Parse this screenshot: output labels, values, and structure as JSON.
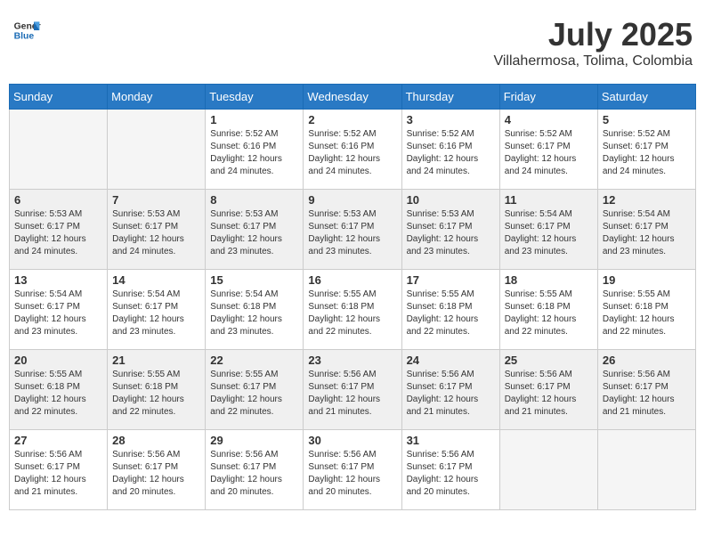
{
  "header": {
    "logo_general": "General",
    "logo_blue": "Blue",
    "month_title": "July 2025",
    "location": "Villahermosa, Tolima, Colombia"
  },
  "weekdays": [
    "Sunday",
    "Monday",
    "Tuesday",
    "Wednesday",
    "Thursday",
    "Friday",
    "Saturday"
  ],
  "weeks": [
    [
      {
        "day": "",
        "info": ""
      },
      {
        "day": "",
        "info": ""
      },
      {
        "day": "1",
        "info": "Sunrise: 5:52 AM\nSunset: 6:16 PM\nDaylight: 12 hours and 24 minutes."
      },
      {
        "day": "2",
        "info": "Sunrise: 5:52 AM\nSunset: 6:16 PM\nDaylight: 12 hours and 24 minutes."
      },
      {
        "day": "3",
        "info": "Sunrise: 5:52 AM\nSunset: 6:16 PM\nDaylight: 12 hours and 24 minutes."
      },
      {
        "day": "4",
        "info": "Sunrise: 5:52 AM\nSunset: 6:17 PM\nDaylight: 12 hours and 24 minutes."
      },
      {
        "day": "5",
        "info": "Sunrise: 5:52 AM\nSunset: 6:17 PM\nDaylight: 12 hours and 24 minutes."
      }
    ],
    [
      {
        "day": "6",
        "info": "Sunrise: 5:53 AM\nSunset: 6:17 PM\nDaylight: 12 hours and 24 minutes."
      },
      {
        "day": "7",
        "info": "Sunrise: 5:53 AM\nSunset: 6:17 PM\nDaylight: 12 hours and 24 minutes."
      },
      {
        "day": "8",
        "info": "Sunrise: 5:53 AM\nSunset: 6:17 PM\nDaylight: 12 hours and 23 minutes."
      },
      {
        "day": "9",
        "info": "Sunrise: 5:53 AM\nSunset: 6:17 PM\nDaylight: 12 hours and 23 minutes."
      },
      {
        "day": "10",
        "info": "Sunrise: 5:53 AM\nSunset: 6:17 PM\nDaylight: 12 hours and 23 minutes."
      },
      {
        "day": "11",
        "info": "Sunrise: 5:54 AM\nSunset: 6:17 PM\nDaylight: 12 hours and 23 minutes."
      },
      {
        "day": "12",
        "info": "Sunrise: 5:54 AM\nSunset: 6:17 PM\nDaylight: 12 hours and 23 minutes."
      }
    ],
    [
      {
        "day": "13",
        "info": "Sunrise: 5:54 AM\nSunset: 6:17 PM\nDaylight: 12 hours and 23 minutes."
      },
      {
        "day": "14",
        "info": "Sunrise: 5:54 AM\nSunset: 6:17 PM\nDaylight: 12 hours and 23 minutes."
      },
      {
        "day": "15",
        "info": "Sunrise: 5:54 AM\nSunset: 6:18 PM\nDaylight: 12 hours and 23 minutes."
      },
      {
        "day": "16",
        "info": "Sunrise: 5:55 AM\nSunset: 6:18 PM\nDaylight: 12 hours and 22 minutes."
      },
      {
        "day": "17",
        "info": "Sunrise: 5:55 AM\nSunset: 6:18 PM\nDaylight: 12 hours and 22 minutes."
      },
      {
        "day": "18",
        "info": "Sunrise: 5:55 AM\nSunset: 6:18 PM\nDaylight: 12 hours and 22 minutes."
      },
      {
        "day": "19",
        "info": "Sunrise: 5:55 AM\nSunset: 6:18 PM\nDaylight: 12 hours and 22 minutes."
      }
    ],
    [
      {
        "day": "20",
        "info": "Sunrise: 5:55 AM\nSunset: 6:18 PM\nDaylight: 12 hours and 22 minutes."
      },
      {
        "day": "21",
        "info": "Sunrise: 5:55 AM\nSunset: 6:18 PM\nDaylight: 12 hours and 22 minutes."
      },
      {
        "day": "22",
        "info": "Sunrise: 5:55 AM\nSunset: 6:17 PM\nDaylight: 12 hours and 22 minutes."
      },
      {
        "day": "23",
        "info": "Sunrise: 5:56 AM\nSunset: 6:17 PM\nDaylight: 12 hours and 21 minutes."
      },
      {
        "day": "24",
        "info": "Sunrise: 5:56 AM\nSunset: 6:17 PM\nDaylight: 12 hours and 21 minutes."
      },
      {
        "day": "25",
        "info": "Sunrise: 5:56 AM\nSunset: 6:17 PM\nDaylight: 12 hours and 21 minutes."
      },
      {
        "day": "26",
        "info": "Sunrise: 5:56 AM\nSunset: 6:17 PM\nDaylight: 12 hours and 21 minutes."
      }
    ],
    [
      {
        "day": "27",
        "info": "Sunrise: 5:56 AM\nSunset: 6:17 PM\nDaylight: 12 hours and 21 minutes."
      },
      {
        "day": "28",
        "info": "Sunrise: 5:56 AM\nSunset: 6:17 PM\nDaylight: 12 hours and 20 minutes."
      },
      {
        "day": "29",
        "info": "Sunrise: 5:56 AM\nSunset: 6:17 PM\nDaylight: 12 hours and 20 minutes."
      },
      {
        "day": "30",
        "info": "Sunrise: 5:56 AM\nSunset: 6:17 PM\nDaylight: 12 hours and 20 minutes."
      },
      {
        "day": "31",
        "info": "Sunrise: 5:56 AM\nSunset: 6:17 PM\nDaylight: 12 hours and 20 minutes."
      },
      {
        "day": "",
        "info": ""
      },
      {
        "day": "",
        "info": ""
      }
    ]
  ]
}
